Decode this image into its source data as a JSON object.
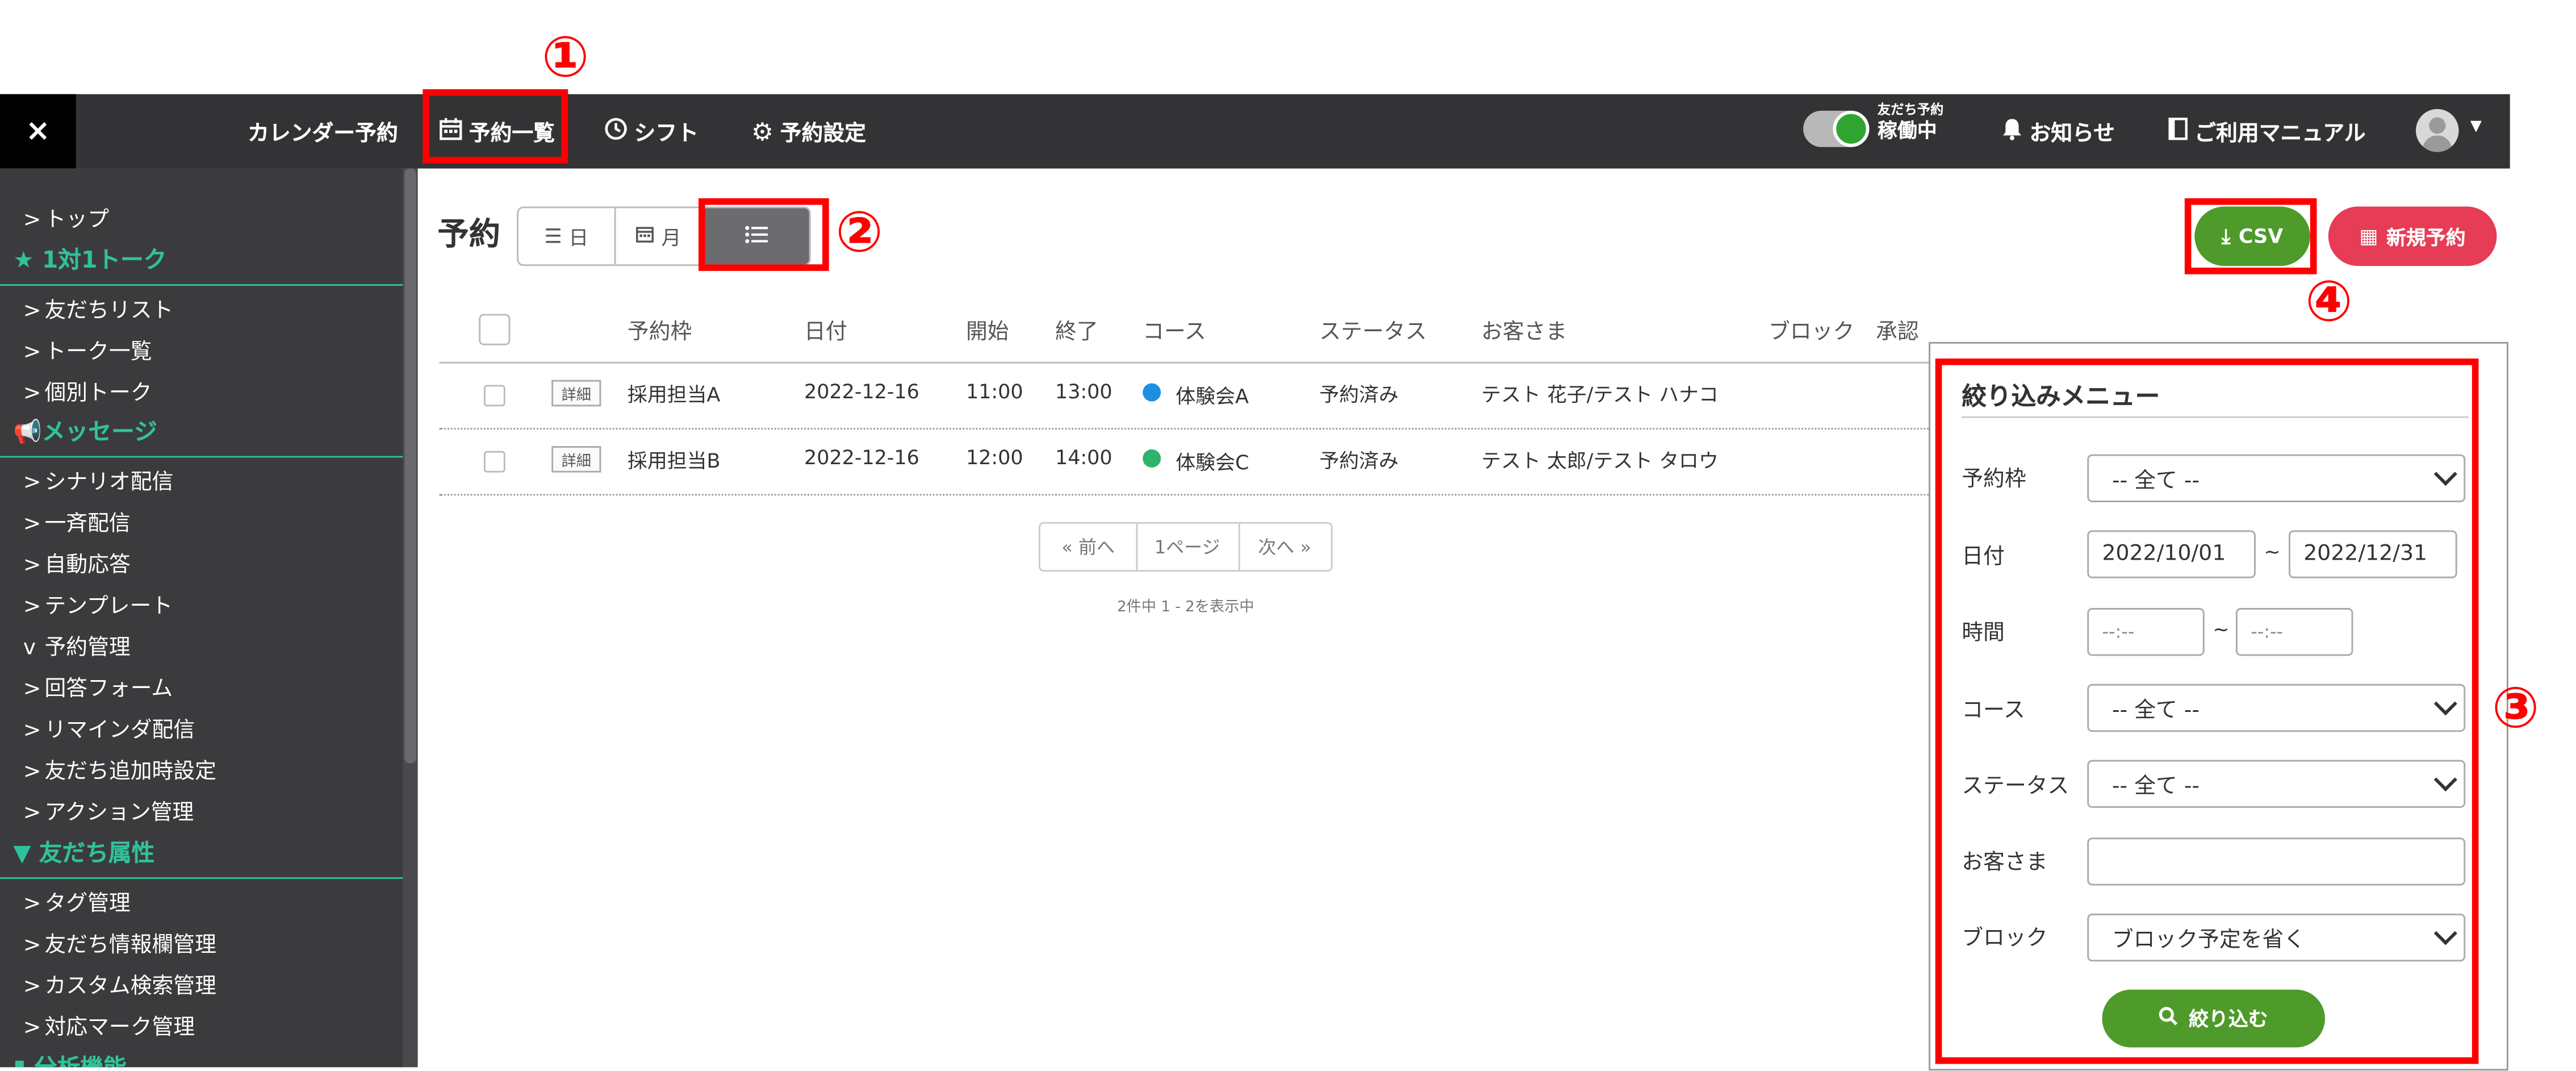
{
  "topbar": {
    "close_icon": "×",
    "nav": [
      {
        "label": "カレンダー予約",
        "icon": ""
      },
      {
        "label": "予約一覧",
        "icon": "calendar-icon"
      },
      {
        "label": "シフト",
        "icon": "clock-icon"
      },
      {
        "label": "予約設定",
        "icon": "gear-icon"
      }
    ],
    "toggle": {
      "small": "友だち予約",
      "big": "稼働中",
      "on": true
    },
    "notice": "お知らせ",
    "manual": "ご利用マニュアル"
  },
  "sidebar": {
    "top": "トップ",
    "sections": [
      {
        "heading": "1対1トーク",
        "icon": "★",
        "items": [
          "友だちリスト",
          "トーク一覧",
          "個別トーク"
        ]
      },
      {
        "heading": "メッセージ",
        "icon": "megaphone",
        "items": [
          "シナリオ配信",
          "一斉配信",
          "自動応答",
          "テンプレート",
          "予約管理",
          "回答フォーム",
          "リマインダ配信",
          "友だち追加時設定",
          "アクション管理"
        ]
      },
      {
        "heading": "友だち属性",
        "icon": "filter",
        "items": [
          "タグ管理",
          "友だち情報欄管理",
          "カスタム検索管理",
          "対応マーク管理"
        ]
      },
      {
        "heading": "分析機能",
        "icon": "chart",
        "items": []
      }
    ]
  },
  "main": {
    "title": "予約",
    "views": {
      "day": "日",
      "month": "月",
      "list": ""
    },
    "csv_label": "CSV",
    "new_label": "新規予約",
    "table": {
      "headers": [
        "予約枠",
        "日付",
        "開始",
        "終了",
        "コース",
        "ステータス",
        "お客さま",
        "ブロック",
        "承認"
      ],
      "detail_label": "詳細",
      "rows": [
        {
          "slot": "採用担当A",
          "date": "2022-12-16",
          "start": "11:00",
          "end": "13:00",
          "course": "体験会A",
          "course_color": "#1e8fe0",
          "status": "予約済み",
          "customer": "テスト 花子/テスト ハナコ"
        },
        {
          "slot": "採用担当B",
          "date": "2022-12-16",
          "start": "12:00",
          "end": "14:00",
          "course": "体験会C",
          "course_color": "#2fb36b",
          "status": "予約済み",
          "customer": "テスト 太郎/テスト タロウ"
        }
      ]
    },
    "pager": {
      "prev": "« 前へ",
      "current": "1ページ",
      "next": "次へ »",
      "info": "2件中 1 - 2を表示中"
    }
  },
  "filter": {
    "title": "絞り込みメニュー",
    "labels": {
      "slot": "予約枠",
      "date": "日付",
      "time": "時間",
      "course": "コース",
      "status": "ステータス",
      "customer": "お客さま",
      "block": "ブロック"
    },
    "slot_value": "-- 全て --",
    "date_from": "2022/10/01",
    "date_to": "2022/12/31",
    "time_from": "--:--",
    "time_to": "--:--",
    "tilde": "~",
    "course_value": "-- 全て --",
    "status_value": "-- 全て --",
    "customer_value": "",
    "block_value": "ブロック予定を省く",
    "submit_label": "絞り込む"
  },
  "annotations": {
    "n1": "①",
    "n2": "②",
    "n3": "③",
    "n4": "④",
    "color": "#ff0000"
  }
}
